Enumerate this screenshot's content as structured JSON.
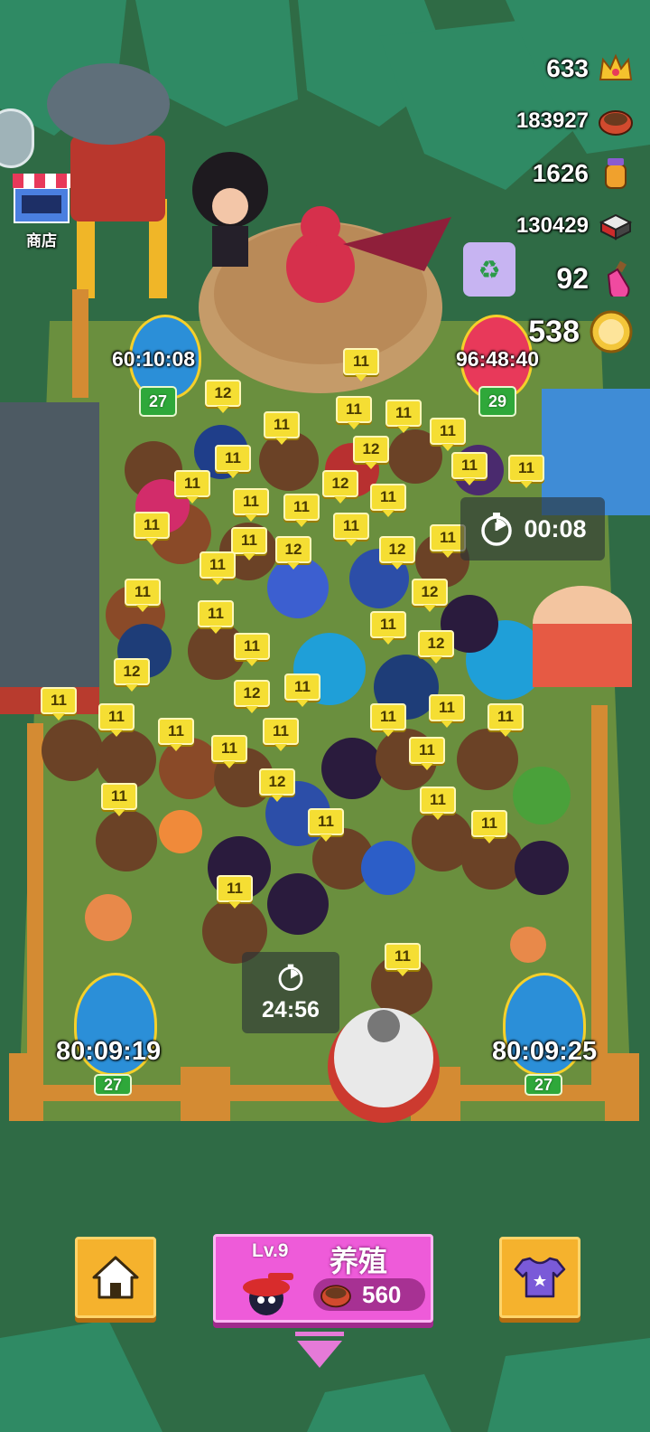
{
  "currencies": [
    {
      "value": "633",
      "icon": "crown-icon"
    },
    {
      "value": "183927",
      "icon": "food-bowl-icon"
    },
    {
      "value": "1626",
      "icon": "jar-icon"
    },
    {
      "value": "130429",
      "icon": "ingot-icon"
    },
    {
      "value": "92",
      "icon": "potion-icon"
    },
    {
      "value": "538",
      "icon": "gold-coin-icon"
    }
  ],
  "shop": {
    "label": "商店"
  },
  "eggs": [
    {
      "timer": "60:10:08",
      "level": "27",
      "color": "#2b8fd8"
    },
    {
      "timer": "96:48:40",
      "level": "29",
      "color": "#e8395a"
    },
    {
      "timer": "80:09:19",
      "level": "27",
      "color": "#2b8fd8"
    },
    {
      "timer": "80:09:25",
      "level": "27",
      "color": "#2b8fd8"
    }
  ],
  "creature_tags": [
    "11",
    "12",
    "11",
    "11",
    "11",
    "11",
    "12",
    "11",
    "11",
    "11",
    "11",
    "12",
    "11",
    "11",
    "11",
    "11",
    "11",
    "11",
    "11",
    "12",
    "12",
    "11",
    "11",
    "12",
    "11",
    "11",
    "12",
    "11",
    "12",
    "11",
    "12",
    "11",
    "11",
    "11",
    "11",
    "11",
    "11",
    "11",
    "11",
    "12",
    "11",
    "11",
    "11",
    "11",
    "11",
    "11",
    "11",
    "11",
    "11",
    "11",
    "11",
    "11"
  ],
  "countdowns": [
    {
      "time": "00:08",
      "icon": "stopwatch-icon"
    },
    {
      "time": "24:56",
      "icon": "stopwatch-icon"
    }
  ],
  "bottom_bar": {
    "home_icon": "home-icon",
    "shirt_icon": "shirt-icon",
    "breed": {
      "level": "Lv.9",
      "label": "养殖",
      "cost": "560",
      "cost_icon": "food-bowl-icon"
    }
  },
  "colors": {
    "accent_pink": "#ee5bd9",
    "button_orange": "#f5b22d",
    "tag_yellow": "#f5de33",
    "level_green": "#2fa83a"
  }
}
